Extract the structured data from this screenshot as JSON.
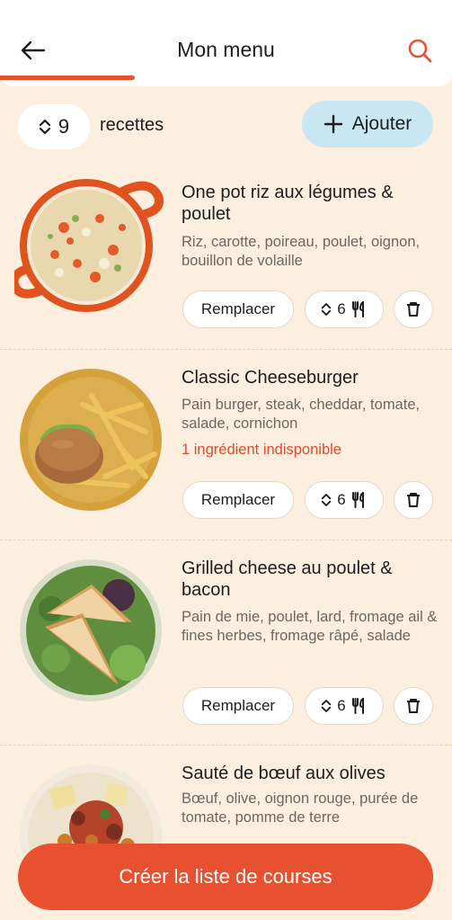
{
  "header": {
    "title": "Mon menu",
    "back_icon": "arrow-left-icon",
    "search_icon": "search-icon"
  },
  "toolbar": {
    "count": "9",
    "count_label": "recettes",
    "add_label": "Ajouter"
  },
  "recipes": [
    {
      "name": "One pot riz aux légumes & poulet",
      "ingredients": "Riz, carotte, poireau, poulet, oignon, bouillon de volaille",
      "warning": "",
      "servings": "6",
      "replace_label": "Remplacer"
    },
    {
      "name": "Classic Cheeseburger",
      "ingredients": "Pain burger, steak, cheddar, tomate, salade, cornichon",
      "warning": "1 ingrédient indisponible",
      "servings": "6",
      "replace_label": "Remplacer"
    },
    {
      "name": "Grilled cheese au poulet & bacon",
      "ingredients": "Pain de mie, poulet, lard, fromage ail & fines herbes, fromage râpé, salade",
      "warning": "",
      "servings": "6",
      "replace_label": "Remplacer"
    },
    {
      "name": "Sauté de bœuf aux olives",
      "ingredients": "Bœuf, olive, oignon rouge, purée de tomate, pomme de terre",
      "warning": "",
      "servings": "",
      "replace_label": ""
    }
  ],
  "cta": {
    "label": "Créer la liste de courses"
  },
  "colors": {
    "background": "#FCEFDF",
    "accent": "#E8512F",
    "add_button": "#C9E7F2",
    "warning": "#DE4A2C"
  }
}
